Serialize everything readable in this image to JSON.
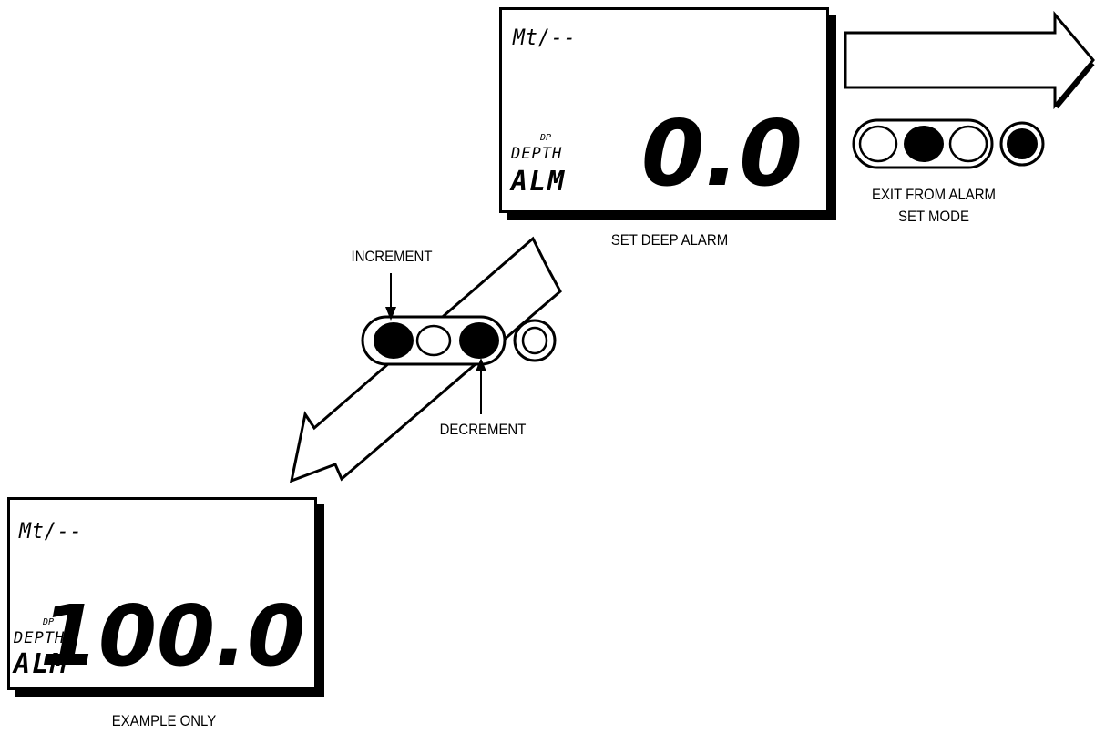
{
  "top_display": {
    "mode": "Mt/--",
    "dp": "DP",
    "depth": "DEPTH",
    "alm": "ALM",
    "value": "0.0",
    "caption": "SET DEEP ALARM"
  },
  "bottom_display": {
    "mode": "Mt/--",
    "dp": "DP",
    "depth": "DEPTH",
    "alm": "ALM",
    "value": "100.0",
    "caption": "EXAMPLE ONLY"
  },
  "buttons_middle": {
    "increment_label": "INCREMENT",
    "decrement_label": "DECREMENT"
  },
  "buttons_right": {
    "caption_line1": "EXIT FROM ALARM",
    "caption_line2": "SET MODE"
  }
}
